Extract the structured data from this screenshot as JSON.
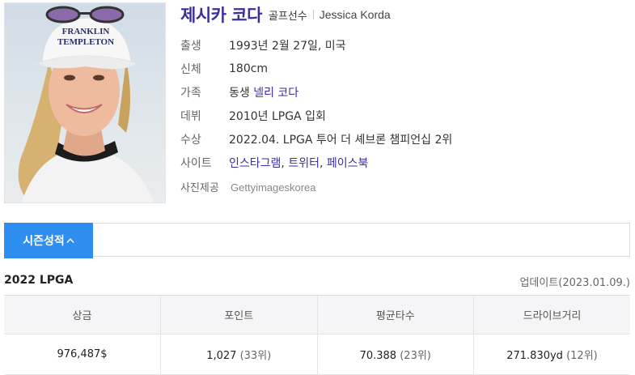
{
  "profile": {
    "name": "제시카 코다",
    "role": "골프선수",
    "english_name": "Jessica Korda",
    "photo_alt": "Jessica Korda photo",
    "info": [
      {
        "label": "출생",
        "value": "1993년 2월 27일, 미국"
      },
      {
        "label": "신체",
        "value": "180cm"
      },
      {
        "label": "가족",
        "prefix": "동생 ",
        "link": "넬리 코다"
      },
      {
        "label": "데뷔",
        "value": "2010년 LPGA 입회"
      },
      {
        "label": "수상",
        "value": "2022.04. LPGA 투어 더 셰브론 챔피언십 2위"
      },
      {
        "label": "사이트",
        "links": [
          "인스타그램",
          "트위터",
          "페이스북"
        ]
      }
    ],
    "photo_credit_label": "사진제공",
    "photo_credit": "Gettyimageskorea",
    "hat_text": [
      "FRANKLIN",
      "TEMPLETON"
    ]
  },
  "tabs": {
    "active_label": "시즌성적"
  },
  "season": {
    "title": "2022 LPGA",
    "update": "업데이트(2023.01.09.)",
    "columns": [
      "상금",
      "포인트",
      "평균타수",
      "드라이브거리"
    ],
    "row": [
      {
        "value": "976,487$",
        "rank": ""
      },
      {
        "value": "1,027",
        "rank": "(33위)"
      },
      {
        "value": "70.388",
        "rank": "(23위)"
      },
      {
        "value": "271.830yd",
        "rank": "(12위)"
      }
    ]
  },
  "colors": {
    "accent": "#2e8ef0",
    "name": "#3a2fa0"
  }
}
